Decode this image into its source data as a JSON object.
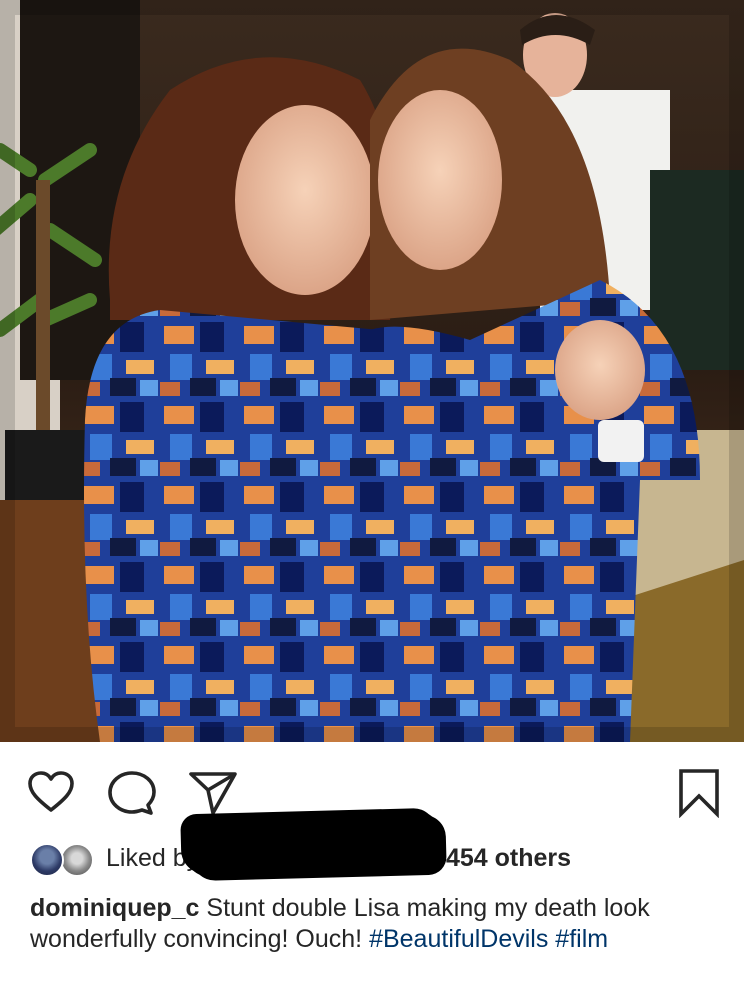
{
  "post": {
    "photo_alt": "Two women in matching blue and orange patterned dresses smiling"
  },
  "actions": {
    "like_icon": "heart-outline-icon",
    "comment_icon": "comment-bubble-icon",
    "share_icon": "paper-plane-icon",
    "save_icon": "bookmark-outline-icon"
  },
  "likes": {
    "prefix": "Liked by",
    "count_text": "454 others"
  },
  "caption": {
    "username": "dominiquep_c",
    "text_part1": "Stunt double Lisa making my death look wonderfully convincing! Ouch!",
    "hashtag1": "#BeautifulDevils",
    "hashtag2": "#film"
  },
  "colors": {
    "hashtag": "#003569",
    "text": "#262626"
  }
}
